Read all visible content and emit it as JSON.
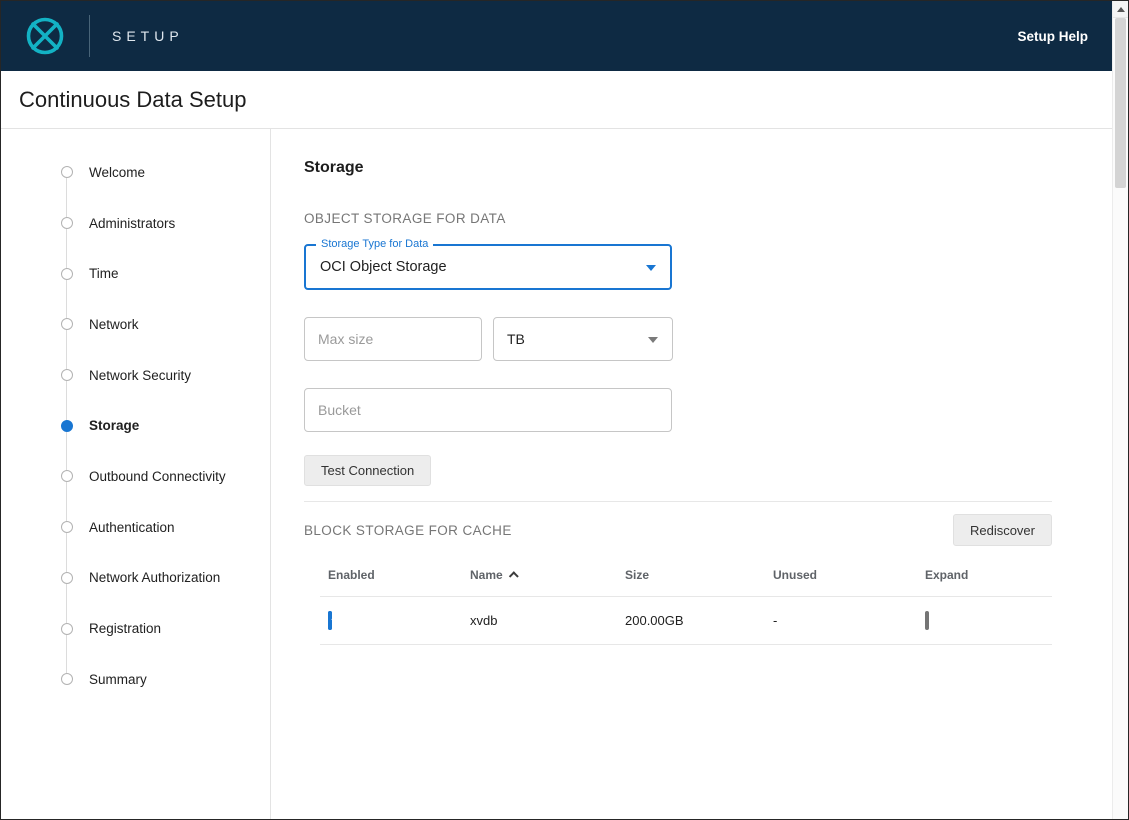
{
  "topbar": {
    "app_name": "SETUP",
    "help_label": "Setup Help",
    "logo_icon": "delphix-logo-icon"
  },
  "page": {
    "title": "Continuous Data Setup"
  },
  "stepper": {
    "items": [
      {
        "label": "Welcome",
        "active": false
      },
      {
        "label": "Administrators",
        "active": false
      },
      {
        "label": "Time",
        "active": false
      },
      {
        "label": "Network",
        "active": false
      },
      {
        "label": "Network Security",
        "active": false
      },
      {
        "label": "Storage",
        "active": true
      },
      {
        "label": "Outbound Connectivity",
        "active": false
      },
      {
        "label": "Authentication",
        "active": false
      },
      {
        "label": "Network Authorization",
        "active": false
      },
      {
        "label": "Registration",
        "active": false
      },
      {
        "label": "Summary",
        "active": false
      }
    ]
  },
  "main": {
    "title": "Storage",
    "object_storage": {
      "section_label": "OBJECT STORAGE FOR DATA",
      "storage_type_label": "Storage Type for Data",
      "storage_type_value": "OCI Object Storage",
      "max_size_placeholder": "Max size",
      "unit_value": "TB",
      "bucket_placeholder": "Bucket",
      "test_connection_label": "Test Connection"
    },
    "block_storage": {
      "section_label": "BLOCK STORAGE FOR CACHE",
      "rediscover_label": "Rediscover",
      "table": {
        "headers": {
          "enabled": "Enabled",
          "name": "Name",
          "size": "Size",
          "unused": "Unused",
          "expand": "Expand"
        },
        "sort": {
          "column": "Name",
          "direction": "asc"
        },
        "rows": [
          {
            "enabled": true,
            "name": "xvdb",
            "size": "200.00GB",
            "unused": "-",
            "expand": false
          }
        ]
      }
    }
  },
  "colors": {
    "topbar_bg": "#0e2a43",
    "accent_blue": "#1976d2",
    "logo_teal": "#13b2c4"
  }
}
